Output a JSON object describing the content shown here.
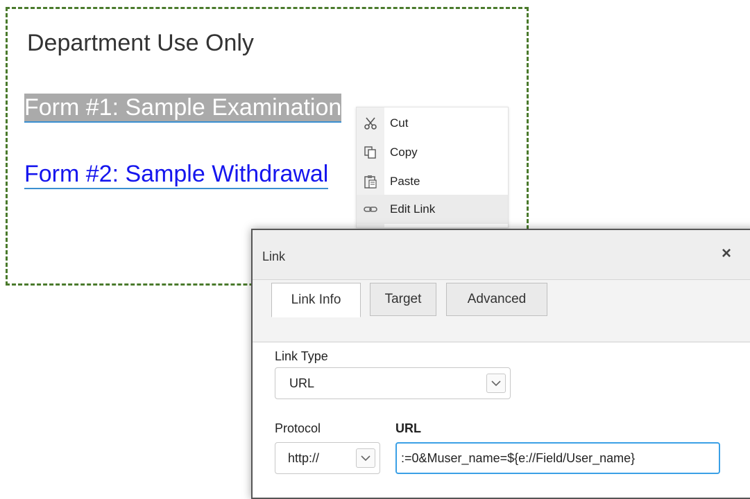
{
  "editor": {
    "heading": "Department Use Only",
    "links": [
      {
        "text": "Form #1: Sample Examination",
        "selected": true
      },
      {
        "text": "Form #2: Sample Withdrawal",
        "selected": false
      }
    ]
  },
  "context_menu": {
    "items": [
      {
        "label": "Cut",
        "icon": "scissors-icon"
      },
      {
        "label": "Copy",
        "icon": "copy-icon"
      },
      {
        "label": "Paste",
        "icon": "paste-icon"
      },
      {
        "label": "Edit Link",
        "icon": "link-icon"
      }
    ]
  },
  "dialog": {
    "title": "Link",
    "close_label": "×",
    "tabs": [
      {
        "label": "Link Info",
        "active": true
      },
      {
        "label": "Target",
        "active": false
      },
      {
        "label": "Advanced",
        "active": false
      }
    ],
    "link_type": {
      "label": "Link Type",
      "value": "URL"
    },
    "protocol": {
      "label": "Protocol",
      "value": "http://"
    },
    "url": {
      "label": "URL",
      "value": ":=0&Muser_name=${e://Field/User_name}"
    }
  },
  "colors": {
    "border_green": "#4a7a2c",
    "link_blue": "#1515ee",
    "focus_blue": "#3aa0e6"
  }
}
